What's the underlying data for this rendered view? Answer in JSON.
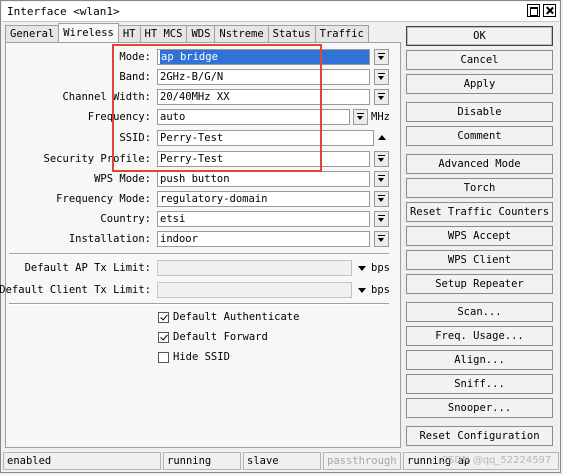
{
  "window": {
    "title": "Interface <wlan1>"
  },
  "tabs": [
    "General",
    "Wireless",
    "HT",
    "HT MCS",
    "WDS",
    "Nstreme",
    "Status",
    "Traffic"
  ],
  "active_tab": "Wireless",
  "form": {
    "mode": {
      "label": "Mode:",
      "value": "ap bridge"
    },
    "band": {
      "label": "Band:",
      "value": "2GHz-B/G/N"
    },
    "channel_width": {
      "label": "Channel Width:",
      "value": "20/40MHz XX"
    },
    "frequency": {
      "label": "Frequency:",
      "value": "auto",
      "unit": "MHz"
    },
    "ssid": {
      "label": "SSID:",
      "value": "Perry-Test"
    },
    "security_profile": {
      "label": "Security Profile:",
      "value": "Perry-Test"
    },
    "wps_mode": {
      "label": "WPS Mode:",
      "value": "push button"
    },
    "frequency_mode": {
      "label": "Frequency Mode:",
      "value": "regulatory-domain"
    },
    "country": {
      "label": "Country:",
      "value": "etsi"
    },
    "installation": {
      "label": "Installation:",
      "value": "indoor"
    },
    "default_ap_tx_limit": {
      "label": "Default AP Tx Limit:",
      "value": "",
      "unit": "bps"
    },
    "default_client_tx_limit": {
      "label": "Default Client Tx Limit:",
      "value": "",
      "unit": "bps"
    },
    "default_authenticate": {
      "label": "Default Authenticate",
      "checked": true
    },
    "default_forward": {
      "label": "Default Forward",
      "checked": true
    },
    "hide_ssid": {
      "label": "Hide SSID",
      "checked": false
    }
  },
  "buttons": {
    "ok": "OK",
    "cancel": "Cancel",
    "apply": "Apply",
    "disable": "Disable",
    "comment": "Comment",
    "advanced_mode": "Advanced Mode",
    "torch": "Torch",
    "reset_traffic_counters": "Reset Traffic Counters",
    "wps_accept": "WPS Accept",
    "wps_client": "WPS Client",
    "setup_repeater": "Setup Repeater",
    "scan": "Scan...",
    "freq_usage": "Freq. Usage...",
    "align": "Align...",
    "sniff": "Sniff...",
    "snooper": "Snooper...",
    "reset_configuration": "Reset Configuration"
  },
  "status_bar": [
    "enabled",
    "running",
    "slave",
    "passthrough",
    "running ap"
  ],
  "watermark": "CSDN @qq_52224597",
  "colors": {
    "highlight_box": "#e0443a",
    "selection": "#3072d6"
  }
}
